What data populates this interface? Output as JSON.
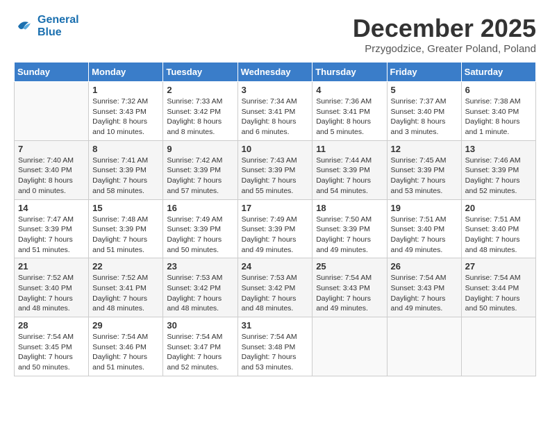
{
  "header": {
    "logo_line1": "General",
    "logo_line2": "Blue",
    "month_title": "December 2025",
    "subtitle": "Przygodzice, Greater Poland, Poland"
  },
  "weekdays": [
    "Sunday",
    "Monday",
    "Tuesday",
    "Wednesday",
    "Thursday",
    "Friday",
    "Saturday"
  ],
  "weeks": [
    [
      {
        "day": "",
        "info": ""
      },
      {
        "day": "1",
        "info": "Sunrise: 7:32 AM\nSunset: 3:43 PM\nDaylight: 8 hours and 10 minutes."
      },
      {
        "day": "2",
        "info": "Sunrise: 7:33 AM\nSunset: 3:42 PM\nDaylight: 8 hours and 8 minutes."
      },
      {
        "day": "3",
        "info": "Sunrise: 7:34 AM\nSunset: 3:41 PM\nDaylight: 8 hours and 6 minutes."
      },
      {
        "day": "4",
        "info": "Sunrise: 7:36 AM\nSunset: 3:41 PM\nDaylight: 8 hours and 5 minutes."
      },
      {
        "day": "5",
        "info": "Sunrise: 7:37 AM\nSunset: 3:40 PM\nDaylight: 8 hours and 3 minutes."
      },
      {
        "day": "6",
        "info": "Sunrise: 7:38 AM\nSunset: 3:40 PM\nDaylight: 8 hours and 1 minute."
      }
    ],
    [
      {
        "day": "7",
        "info": "Sunrise: 7:40 AM\nSunset: 3:40 PM\nDaylight: 8 hours and 0 minutes."
      },
      {
        "day": "8",
        "info": "Sunrise: 7:41 AM\nSunset: 3:39 PM\nDaylight: 7 hours and 58 minutes."
      },
      {
        "day": "9",
        "info": "Sunrise: 7:42 AM\nSunset: 3:39 PM\nDaylight: 7 hours and 57 minutes."
      },
      {
        "day": "10",
        "info": "Sunrise: 7:43 AM\nSunset: 3:39 PM\nDaylight: 7 hours and 55 minutes."
      },
      {
        "day": "11",
        "info": "Sunrise: 7:44 AM\nSunset: 3:39 PM\nDaylight: 7 hours and 54 minutes."
      },
      {
        "day": "12",
        "info": "Sunrise: 7:45 AM\nSunset: 3:39 PM\nDaylight: 7 hours and 53 minutes."
      },
      {
        "day": "13",
        "info": "Sunrise: 7:46 AM\nSunset: 3:39 PM\nDaylight: 7 hours and 52 minutes."
      }
    ],
    [
      {
        "day": "14",
        "info": "Sunrise: 7:47 AM\nSunset: 3:39 PM\nDaylight: 7 hours and 51 minutes."
      },
      {
        "day": "15",
        "info": "Sunrise: 7:48 AM\nSunset: 3:39 PM\nDaylight: 7 hours and 51 minutes."
      },
      {
        "day": "16",
        "info": "Sunrise: 7:49 AM\nSunset: 3:39 PM\nDaylight: 7 hours and 50 minutes."
      },
      {
        "day": "17",
        "info": "Sunrise: 7:49 AM\nSunset: 3:39 PM\nDaylight: 7 hours and 49 minutes."
      },
      {
        "day": "18",
        "info": "Sunrise: 7:50 AM\nSunset: 3:39 PM\nDaylight: 7 hours and 49 minutes."
      },
      {
        "day": "19",
        "info": "Sunrise: 7:51 AM\nSunset: 3:40 PM\nDaylight: 7 hours and 49 minutes."
      },
      {
        "day": "20",
        "info": "Sunrise: 7:51 AM\nSunset: 3:40 PM\nDaylight: 7 hours and 48 minutes."
      }
    ],
    [
      {
        "day": "21",
        "info": "Sunrise: 7:52 AM\nSunset: 3:40 PM\nDaylight: 7 hours and 48 minutes."
      },
      {
        "day": "22",
        "info": "Sunrise: 7:52 AM\nSunset: 3:41 PM\nDaylight: 7 hours and 48 minutes."
      },
      {
        "day": "23",
        "info": "Sunrise: 7:53 AM\nSunset: 3:42 PM\nDaylight: 7 hours and 48 minutes."
      },
      {
        "day": "24",
        "info": "Sunrise: 7:53 AM\nSunset: 3:42 PM\nDaylight: 7 hours and 48 minutes."
      },
      {
        "day": "25",
        "info": "Sunrise: 7:54 AM\nSunset: 3:43 PM\nDaylight: 7 hours and 49 minutes."
      },
      {
        "day": "26",
        "info": "Sunrise: 7:54 AM\nSunset: 3:43 PM\nDaylight: 7 hours and 49 minutes."
      },
      {
        "day": "27",
        "info": "Sunrise: 7:54 AM\nSunset: 3:44 PM\nDaylight: 7 hours and 50 minutes."
      }
    ],
    [
      {
        "day": "28",
        "info": "Sunrise: 7:54 AM\nSunset: 3:45 PM\nDaylight: 7 hours and 50 minutes."
      },
      {
        "day": "29",
        "info": "Sunrise: 7:54 AM\nSunset: 3:46 PM\nDaylight: 7 hours and 51 minutes."
      },
      {
        "day": "30",
        "info": "Sunrise: 7:54 AM\nSunset: 3:47 PM\nDaylight: 7 hours and 52 minutes."
      },
      {
        "day": "31",
        "info": "Sunrise: 7:54 AM\nSunset: 3:48 PM\nDaylight: 7 hours and 53 minutes."
      },
      {
        "day": "",
        "info": ""
      },
      {
        "day": "",
        "info": ""
      },
      {
        "day": "",
        "info": ""
      }
    ]
  ]
}
